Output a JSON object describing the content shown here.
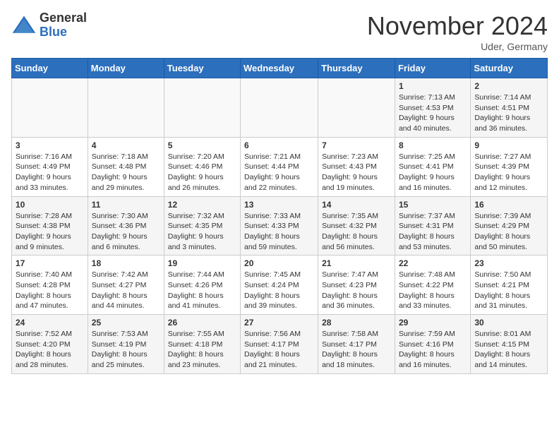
{
  "header": {
    "logo_general": "General",
    "logo_blue": "Blue",
    "month_title": "November 2024",
    "location": "Uder, Germany"
  },
  "weekdays": [
    "Sunday",
    "Monday",
    "Tuesday",
    "Wednesday",
    "Thursday",
    "Friday",
    "Saturday"
  ],
  "weeks": [
    [
      {
        "day": "",
        "info": ""
      },
      {
        "day": "",
        "info": ""
      },
      {
        "day": "",
        "info": ""
      },
      {
        "day": "",
        "info": ""
      },
      {
        "day": "",
        "info": ""
      },
      {
        "day": "1",
        "info": "Sunrise: 7:13 AM\nSunset: 4:53 PM\nDaylight: 9 hours\nand 40 minutes."
      },
      {
        "day": "2",
        "info": "Sunrise: 7:14 AM\nSunset: 4:51 PM\nDaylight: 9 hours\nand 36 minutes."
      }
    ],
    [
      {
        "day": "3",
        "info": "Sunrise: 7:16 AM\nSunset: 4:49 PM\nDaylight: 9 hours\nand 33 minutes."
      },
      {
        "day": "4",
        "info": "Sunrise: 7:18 AM\nSunset: 4:48 PM\nDaylight: 9 hours\nand 29 minutes."
      },
      {
        "day": "5",
        "info": "Sunrise: 7:20 AM\nSunset: 4:46 PM\nDaylight: 9 hours\nand 26 minutes."
      },
      {
        "day": "6",
        "info": "Sunrise: 7:21 AM\nSunset: 4:44 PM\nDaylight: 9 hours\nand 22 minutes."
      },
      {
        "day": "7",
        "info": "Sunrise: 7:23 AM\nSunset: 4:43 PM\nDaylight: 9 hours\nand 19 minutes."
      },
      {
        "day": "8",
        "info": "Sunrise: 7:25 AM\nSunset: 4:41 PM\nDaylight: 9 hours\nand 16 minutes."
      },
      {
        "day": "9",
        "info": "Sunrise: 7:27 AM\nSunset: 4:39 PM\nDaylight: 9 hours\nand 12 minutes."
      }
    ],
    [
      {
        "day": "10",
        "info": "Sunrise: 7:28 AM\nSunset: 4:38 PM\nDaylight: 9 hours\nand 9 minutes."
      },
      {
        "day": "11",
        "info": "Sunrise: 7:30 AM\nSunset: 4:36 PM\nDaylight: 9 hours\nand 6 minutes."
      },
      {
        "day": "12",
        "info": "Sunrise: 7:32 AM\nSunset: 4:35 PM\nDaylight: 9 hours\nand 3 minutes."
      },
      {
        "day": "13",
        "info": "Sunrise: 7:33 AM\nSunset: 4:33 PM\nDaylight: 8 hours\nand 59 minutes."
      },
      {
        "day": "14",
        "info": "Sunrise: 7:35 AM\nSunset: 4:32 PM\nDaylight: 8 hours\nand 56 minutes."
      },
      {
        "day": "15",
        "info": "Sunrise: 7:37 AM\nSunset: 4:31 PM\nDaylight: 8 hours\nand 53 minutes."
      },
      {
        "day": "16",
        "info": "Sunrise: 7:39 AM\nSunset: 4:29 PM\nDaylight: 8 hours\nand 50 minutes."
      }
    ],
    [
      {
        "day": "17",
        "info": "Sunrise: 7:40 AM\nSunset: 4:28 PM\nDaylight: 8 hours\nand 47 minutes."
      },
      {
        "day": "18",
        "info": "Sunrise: 7:42 AM\nSunset: 4:27 PM\nDaylight: 8 hours\nand 44 minutes."
      },
      {
        "day": "19",
        "info": "Sunrise: 7:44 AM\nSunset: 4:26 PM\nDaylight: 8 hours\nand 41 minutes."
      },
      {
        "day": "20",
        "info": "Sunrise: 7:45 AM\nSunset: 4:24 PM\nDaylight: 8 hours\nand 39 minutes."
      },
      {
        "day": "21",
        "info": "Sunrise: 7:47 AM\nSunset: 4:23 PM\nDaylight: 8 hours\nand 36 minutes."
      },
      {
        "day": "22",
        "info": "Sunrise: 7:48 AM\nSunset: 4:22 PM\nDaylight: 8 hours\nand 33 minutes."
      },
      {
        "day": "23",
        "info": "Sunrise: 7:50 AM\nSunset: 4:21 PM\nDaylight: 8 hours\nand 31 minutes."
      }
    ],
    [
      {
        "day": "24",
        "info": "Sunrise: 7:52 AM\nSunset: 4:20 PM\nDaylight: 8 hours\nand 28 minutes."
      },
      {
        "day": "25",
        "info": "Sunrise: 7:53 AM\nSunset: 4:19 PM\nDaylight: 8 hours\nand 25 minutes."
      },
      {
        "day": "26",
        "info": "Sunrise: 7:55 AM\nSunset: 4:18 PM\nDaylight: 8 hours\nand 23 minutes."
      },
      {
        "day": "27",
        "info": "Sunrise: 7:56 AM\nSunset: 4:17 PM\nDaylight: 8 hours\nand 21 minutes."
      },
      {
        "day": "28",
        "info": "Sunrise: 7:58 AM\nSunset: 4:17 PM\nDaylight: 8 hours\nand 18 minutes."
      },
      {
        "day": "29",
        "info": "Sunrise: 7:59 AM\nSunset: 4:16 PM\nDaylight: 8 hours\nand 16 minutes."
      },
      {
        "day": "30",
        "info": "Sunrise: 8:01 AM\nSunset: 4:15 PM\nDaylight: 8 hours\nand 14 minutes."
      }
    ]
  ]
}
